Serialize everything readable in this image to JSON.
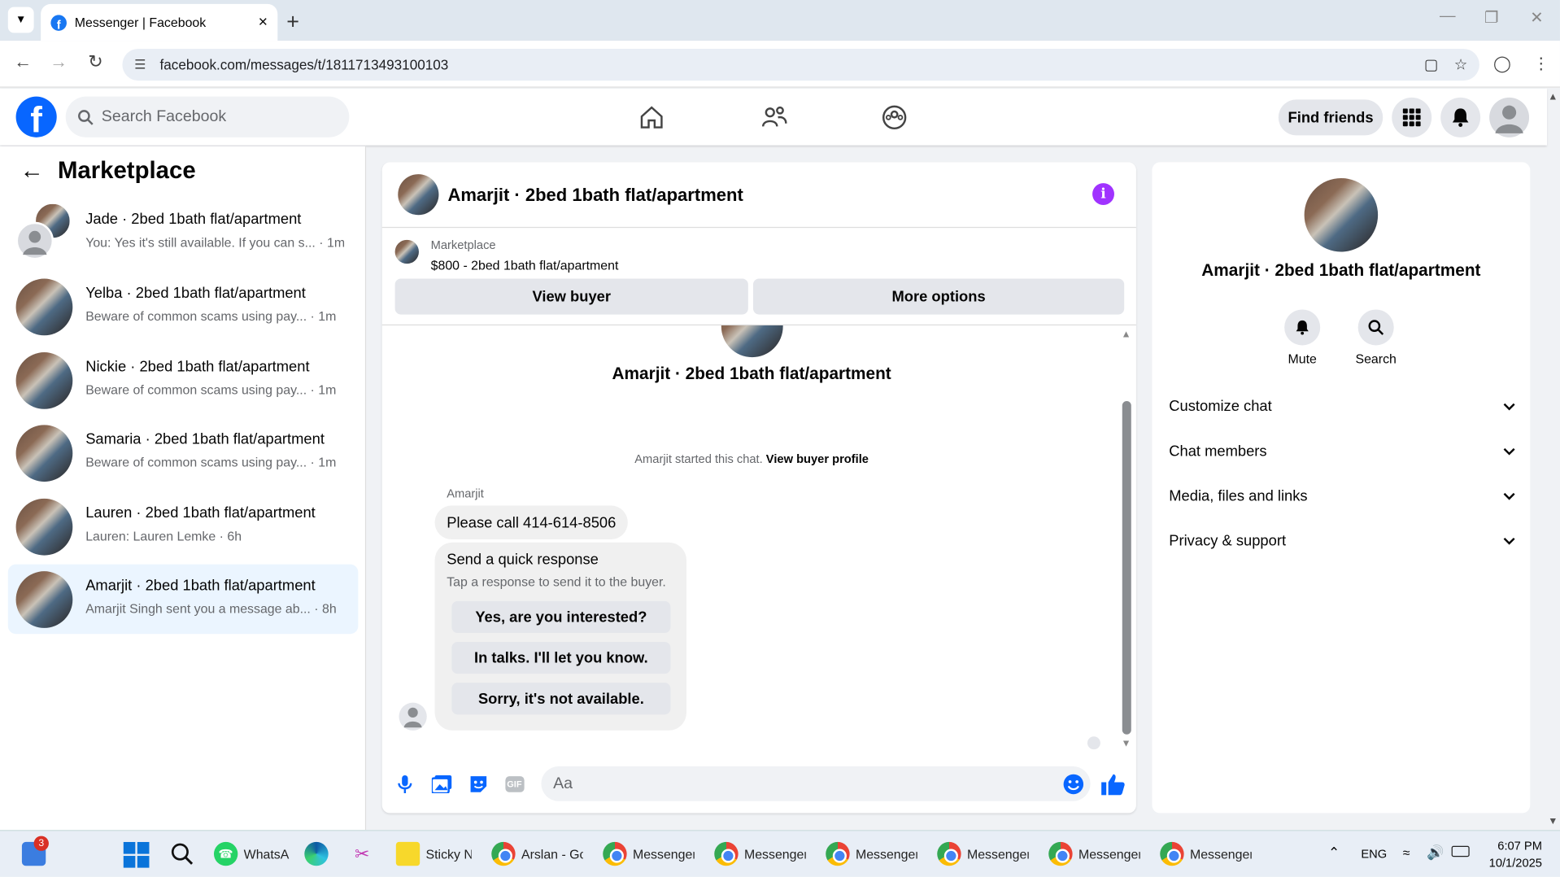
{
  "browser": {
    "tab_title": "Messenger | Facebook",
    "url": "facebook.com/messages/t/1811713493100103"
  },
  "header": {
    "search_placeholder": "Search Facebook",
    "find_friends": "Find friends"
  },
  "left": {
    "title": "Marketplace",
    "threads": [
      {
        "name": "Jade · 2bed 1bath flat/apartment",
        "preview": "You: Yes it's still available. If you can s...",
        "time": "1m"
      },
      {
        "name": "Yelba · 2bed 1bath flat/apartment",
        "preview": "Beware of common scams using pay...",
        "time": "1m"
      },
      {
        "name": "Nickie · 2bed 1bath flat/apartment",
        "preview": "Beware of common scams using pay...",
        "time": "1m"
      },
      {
        "name": "Samaria · 2bed 1bath flat/apartment",
        "preview": "Beware of common scams using pay...",
        "time": "1m"
      },
      {
        "name": "Lauren · 2bed 1bath flat/apartment",
        "preview": "Lauren: Lauren Lemke",
        "time": "6h"
      },
      {
        "name": "Amarjit · 2bed 1bath flat/apartment",
        "preview": "Amarjit Singh sent you a message ab...",
        "time": "8h"
      }
    ]
  },
  "chat": {
    "title": "Amarjit · 2bed 1bath flat/apartment",
    "listing_source": "Marketplace",
    "listing": "$800 - 2bed 1bath flat/apartment",
    "view_buyer": "View buyer",
    "more_options": "More options",
    "intro_name": "Amarjit · 2bed 1bath flat/apartment",
    "started": "Amarjit started this chat.",
    "view_profile": "View buyer profile",
    "sender": "Amarjit",
    "message": "Please call 414-614-8506",
    "quick_title": "Send a quick response",
    "quick_sub": "Tap a response to send it to the buyer.",
    "quick": [
      "Yes, are you interested?",
      "In talks. I'll let you know.",
      "Sorry, it's not available."
    ],
    "compose_placeholder": "Aa",
    "gif": "GIF"
  },
  "right": {
    "name": "Amarjit · 2bed 1bath flat/apartment",
    "mute": "Mute",
    "search": "Search",
    "sections": [
      "Customize chat",
      "Chat members",
      "Media, files and links",
      "Privacy & support"
    ]
  },
  "taskbar": {
    "badge": "3",
    "apps": [
      "WhatsA",
      "Sticky N",
      "Arslan - Gc",
      "Messenger",
      "Messenger",
      "Messenger",
      "Messenger",
      "Messenger",
      "Messenger"
    ],
    "lang": "ENG",
    "time": "6:07 PM",
    "date": "10/1/2025"
  },
  "colors": {
    "accent": "#0866ff",
    "active_thread": "#ebf5ff",
    "info": "#a033ff"
  }
}
